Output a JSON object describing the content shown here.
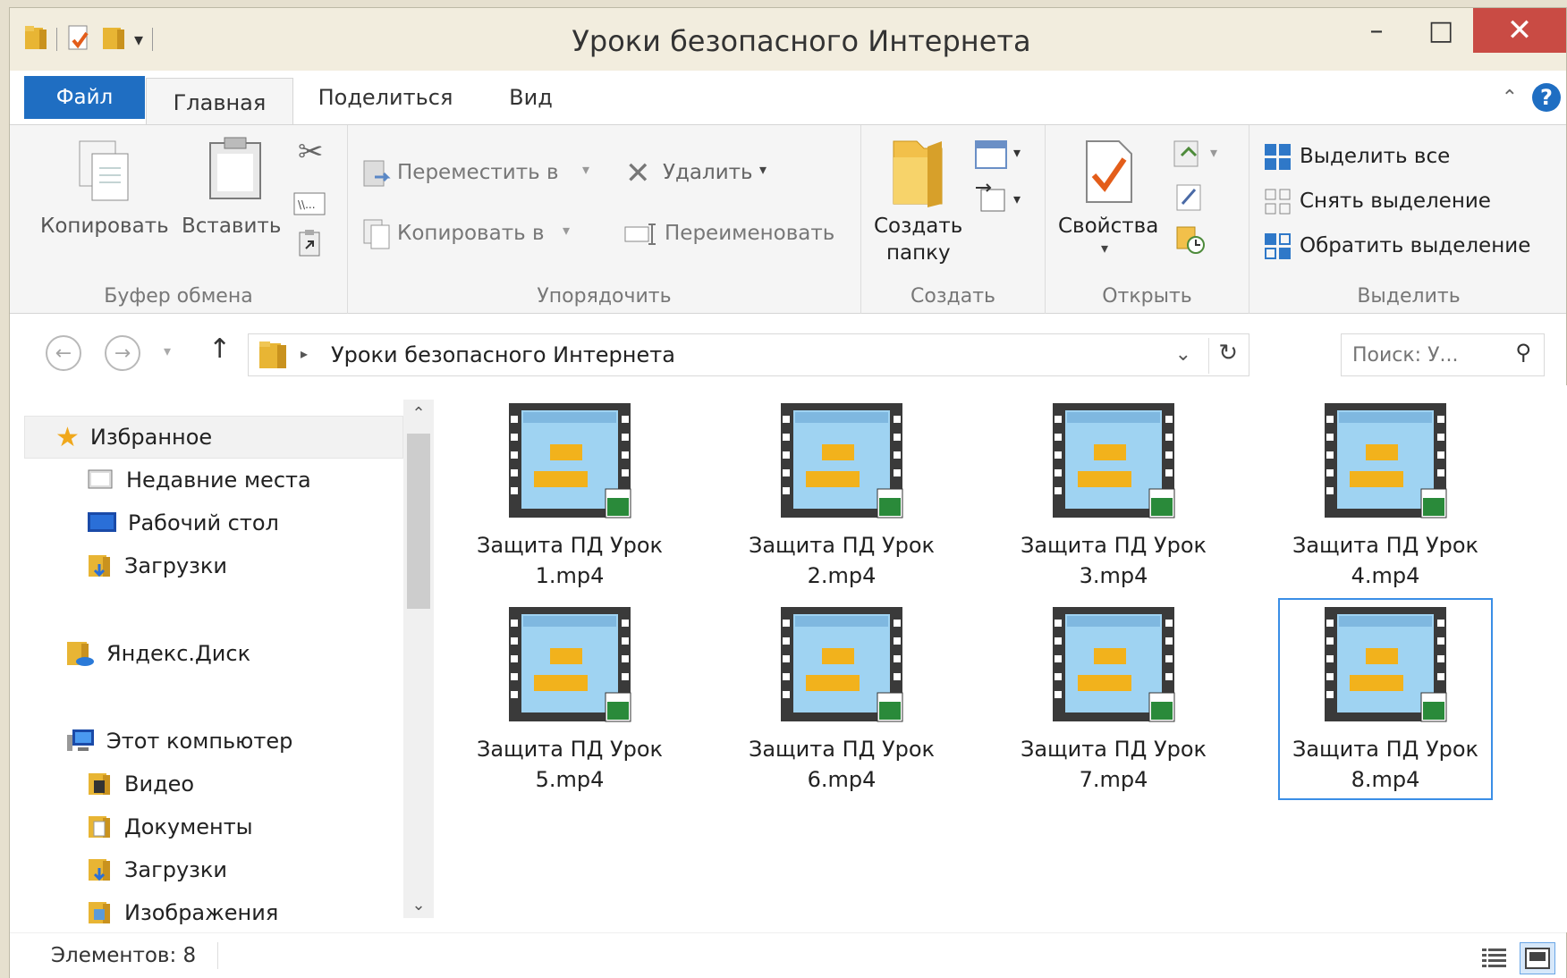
{
  "window": {
    "title": "Уроки безопасного Интернета",
    "minimize_glyph": "–",
    "maximize_glyph": "□",
    "close_glyph": "✕"
  },
  "ribbon_tabs": {
    "file": "Файл",
    "home": "Главная",
    "share": "Поделиться",
    "view": "Вид"
  },
  "ribbon": {
    "clipboard": {
      "copy": "Копировать",
      "paste": "Вставить",
      "label": "Буфер обмена"
    },
    "organize": {
      "move_to": "Переместить в",
      "copy_to": "Копировать в",
      "delete": "Удалить",
      "rename": "Переименовать",
      "label": "Упорядочить"
    },
    "new": {
      "new_folder_line1": "Создать",
      "new_folder_line2": "папку",
      "label": "Создать"
    },
    "open": {
      "properties": "Свойства",
      "label": "Открыть"
    },
    "select": {
      "select_all": "Выделить все",
      "select_none": "Снять выделение",
      "invert": "Обратить выделение",
      "label": "Выделить"
    }
  },
  "address": {
    "path": "Уроки безопасного Интернета",
    "search_placeholder": "Поиск: У..."
  },
  "nav": {
    "favorites": "Избранное",
    "recent": "Недавние места",
    "desktop": "Рабочий стол",
    "downloads_fav": "Загрузки",
    "yandex": "Яндекс.Диск",
    "this_pc": "Этот компьютер",
    "videos": "Видео",
    "documents": "Документы",
    "downloads": "Загрузки",
    "pictures": "Изображения"
  },
  "files": [
    {
      "line1": "Защита ПД Урок",
      "line2": "1.mp4"
    },
    {
      "line1": "Защита ПД Урок",
      "line2": "2.mp4"
    },
    {
      "line1": "Защита ПД Урок",
      "line2": "3.mp4"
    },
    {
      "line1": "Защита ПД Урок",
      "line2": "4.mp4"
    },
    {
      "line1": "Защита ПД Урок",
      "line2": "5.mp4"
    },
    {
      "line1": "Защита ПД Урок",
      "line2": "6.mp4"
    },
    {
      "line1": "Защита ПД Урок",
      "line2": "7.mp4"
    },
    {
      "line1": "Защита ПД Урок",
      "line2": "8.mp4"
    }
  ],
  "status": {
    "items_count": "Элементов: 8"
  },
  "colors": {
    "accent": "#1f6ec2",
    "close_button": "#c94b44",
    "selection_border": "#3a8ee6"
  }
}
